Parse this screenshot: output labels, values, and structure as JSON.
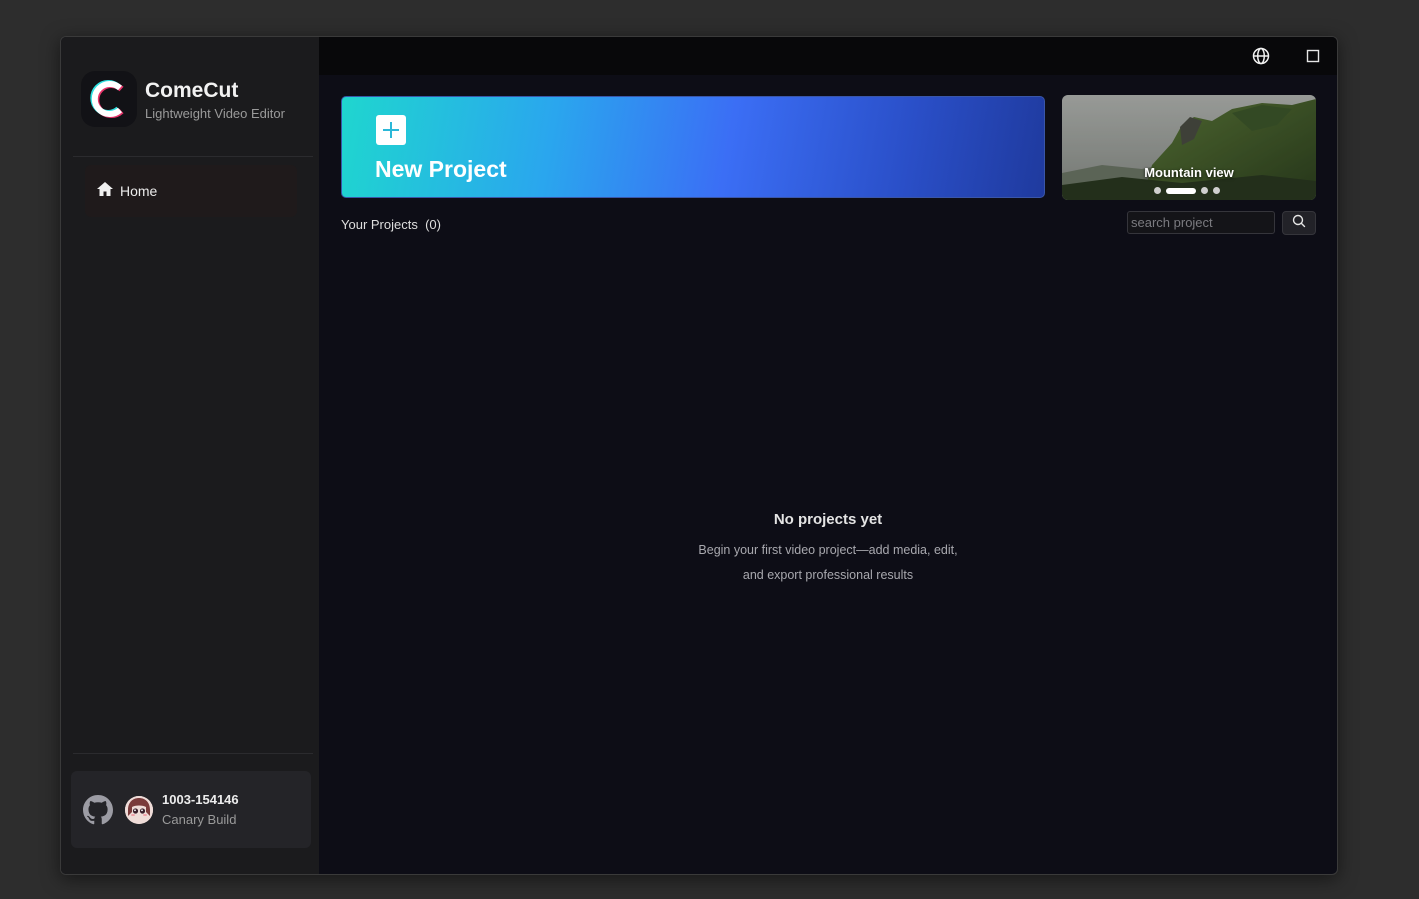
{
  "brand": {
    "name": "ComeCut",
    "subtitle": "Lightweight Video Editor",
    "logo_icon": "comecut-logo-icon"
  },
  "sidebar": {
    "items": [
      {
        "label": "Home",
        "icon": "home-icon",
        "active": true
      }
    ]
  },
  "footer": {
    "build_id": "1003-154146",
    "build_type": "Canary Build",
    "icons": [
      "github-icon",
      "avatar"
    ]
  },
  "topbar": {
    "icons": [
      "globe-icon",
      "maximize-icon"
    ]
  },
  "new_project": {
    "label": "New Project",
    "icon": "plus-icon"
  },
  "carousel": {
    "title": "Mountain view",
    "slides": 4,
    "active_index": 1
  },
  "projects": {
    "label": "Your Projects",
    "count": "(0)"
  },
  "search": {
    "placeholder": "search project",
    "value": ""
  },
  "empty_state": {
    "title": "No projects yet",
    "line1": "Begin your first video project—add media, edit,",
    "line2": "and export professional results"
  },
  "colors": {
    "accent_gradient_start": "#1fd6cf",
    "accent_gradient_end": "#1f3a9e",
    "background": "#0d0d16",
    "sidebar": "#1b1b1d"
  }
}
